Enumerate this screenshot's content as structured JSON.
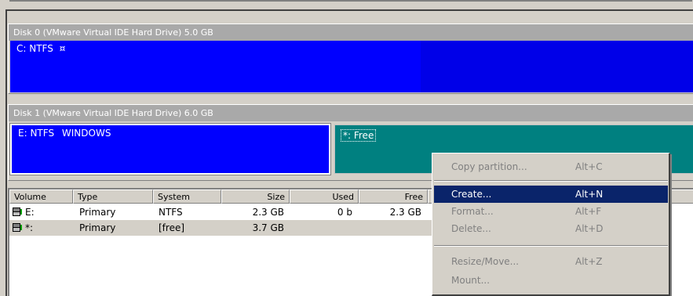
{
  "disks": [
    {
      "title": "Disk 0 (VMware Virtual IDE Hard Drive) 5.0 GB",
      "partitions": [
        {
          "label": "C: NTFS",
          "suffix": "¤",
          "fill": "#0000ff"
        }
      ]
    },
    {
      "title": "Disk 1 (VMware Virtual IDE Hard Drive) 6.0 GB",
      "partitions": [
        {
          "label": "E: NTFS",
          "suffix": "WINDOWS",
          "fill": "#0000ff"
        },
        {
          "label": "*: Free",
          "suffix": "",
          "fill": "#008080"
        }
      ]
    }
  ],
  "volume_list": {
    "columns": [
      "Volume",
      "Type",
      "System",
      "Size",
      "Used",
      "Free"
    ],
    "rows": [
      {
        "volume": "E:",
        "type": "Primary",
        "system": "NTFS",
        "size": "2.3 GB",
        "used": "0 b",
        "free": "2.3 GB"
      },
      {
        "volume": "*:",
        "type": "Primary",
        "system": "[free]",
        "size": "3.7 GB",
        "used": "",
        "free": ""
      }
    ]
  },
  "context_menu": {
    "items": [
      {
        "label": "Copy partition...",
        "shortcut": "Alt+C",
        "enabled": false
      },
      {
        "label": "Create...",
        "shortcut": "Alt+N",
        "enabled": true,
        "highlighted": true
      },
      {
        "label": "Format...",
        "shortcut": "Alt+F",
        "enabled": false
      },
      {
        "label": "Delete...",
        "shortcut": "Alt+D",
        "enabled": false
      },
      {
        "label": "Resize/Move...",
        "shortcut": "Alt+Z",
        "enabled": false
      },
      {
        "label": "Mount...",
        "shortcut": "",
        "enabled": false
      }
    ]
  },
  "colors": {
    "partition_used": "#0000ff",
    "partition_free": "#008080",
    "menu_highlight": "#0a246a"
  }
}
